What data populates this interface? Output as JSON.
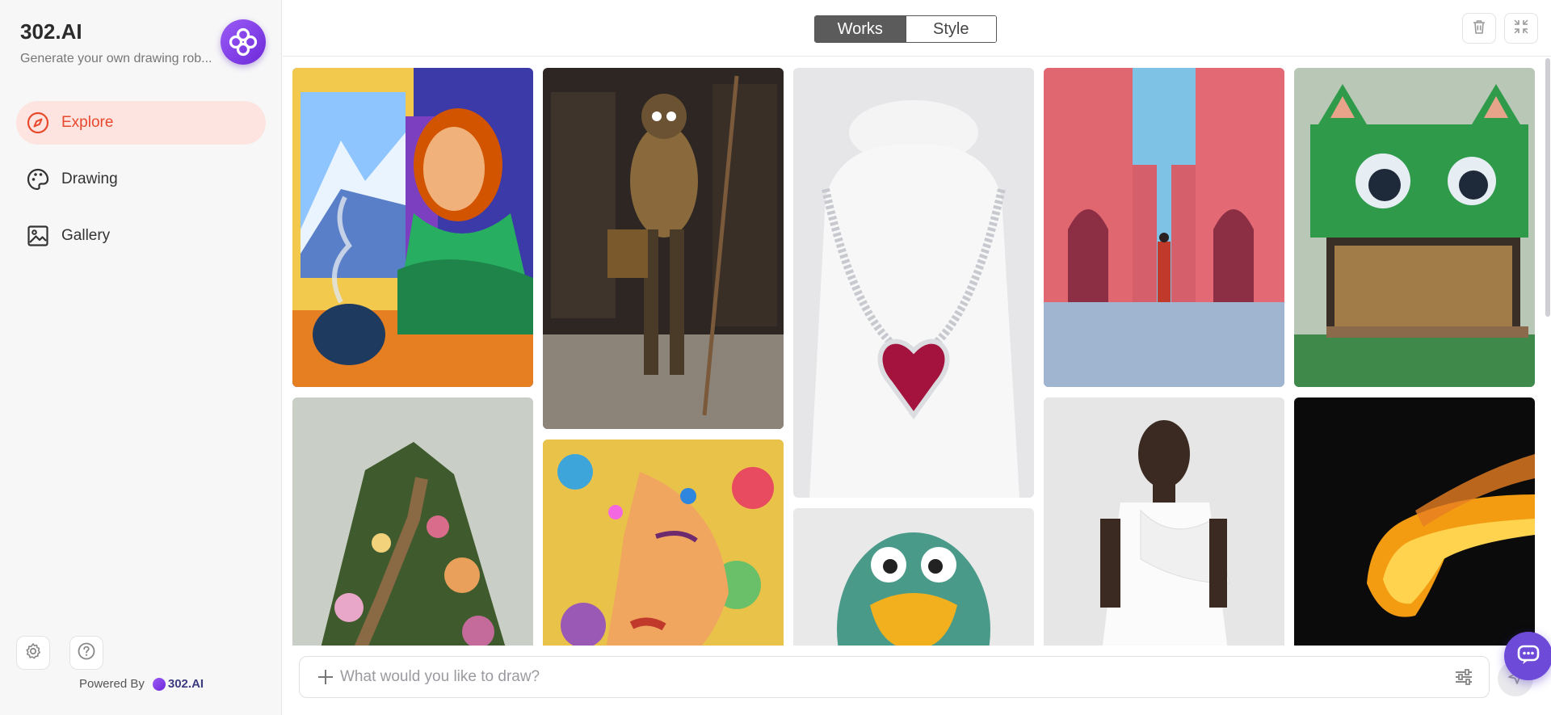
{
  "brand": {
    "title": "302.AI",
    "subtitle": "Generate your own drawing rob...",
    "logo_icon": "flower-logo-icon",
    "accent": "#7c3aed"
  },
  "nav": {
    "items": [
      {
        "label": "Explore",
        "icon": "compass-icon",
        "active": true
      },
      {
        "label": "Drawing",
        "icon": "palette-icon",
        "active": false
      },
      {
        "label": "Gallery",
        "icon": "image-icon",
        "active": false
      }
    ],
    "active_color": "#e8492c",
    "active_bg": "#fde4e0"
  },
  "footer": {
    "powered_by": "Powered By",
    "brand": "302.AI",
    "settings_icon": "gear-icon",
    "help_icon": "help-circle-icon"
  },
  "header": {
    "tabs": [
      {
        "label": "Works",
        "active": true
      },
      {
        "label": "Style",
        "active": false
      }
    ],
    "delete_icon": "trash-icon",
    "collapse_icon": "minimize-icon"
  },
  "gallery": {
    "images": [
      {
        "subject": "bearded man in green sweater drinking coffee, mountain view"
      },
      {
        "subject": "armored horned warrior with spear in library"
      },
      {
        "subject": "ruby heart necklace on white bust"
      },
      {
        "subject": "figure in red robe between pink walls over water"
      },
      {
        "subject": "green cat-shaped container cafe"
      },
      {
        "subject": "staircase of books on flowery hill"
      },
      {
        "subject": "mosaic dotted face portrait"
      },
      {
        "subject": "green knitted bird with yellow beak"
      },
      {
        "subject": "model in white ruffled dress"
      },
      {
        "subject": "fiery glowing head on black background"
      }
    ]
  },
  "prompt": {
    "placeholder": "What would you like to draw?",
    "add_icon": "plus-icon",
    "settings_icon": "sliders-icon",
    "send_icon": "send-icon",
    "chat_icon": "chat-bubble-icon"
  }
}
